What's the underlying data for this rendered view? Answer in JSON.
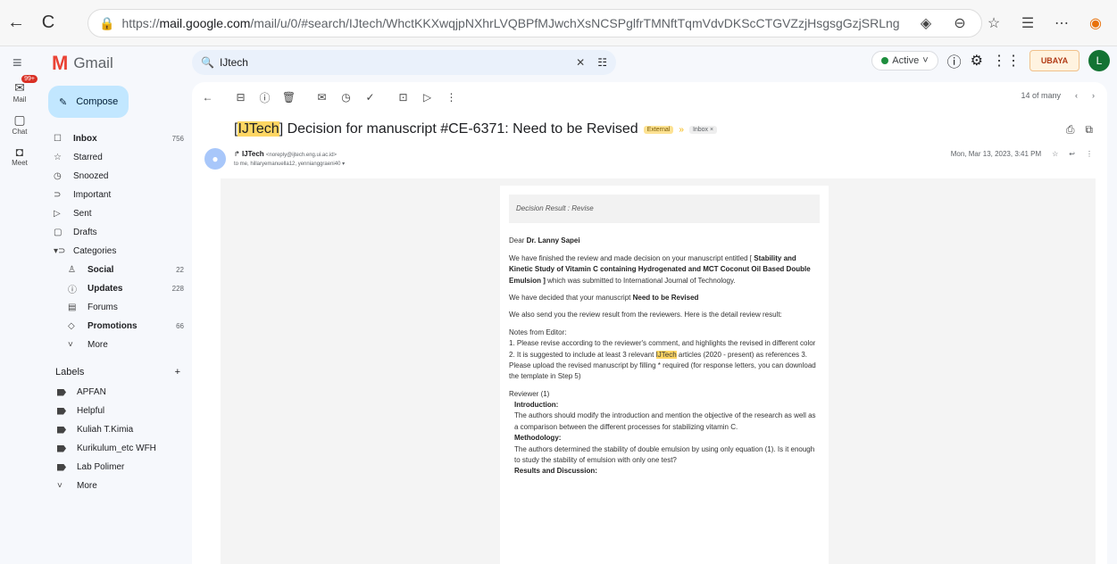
{
  "browser": {
    "back_icon": "←",
    "reload_icon": "C",
    "url_prefix": "https://",
    "url_host": "mail.google.com",
    "url_rest": "/mail/u/0/#search/IJtech/WhctKKXwqjpNXhrLVQBPfMJwchXsNCSPglfrTMNftTqmVdvDKScCTGVZzjHsgsgGzjSRLng"
  },
  "app": {
    "name": "Gmail"
  },
  "search": {
    "query": "IJtech"
  },
  "status": {
    "active_label": "Active"
  },
  "account": {
    "initial": "L",
    "org_badge": "UBAYA"
  },
  "rail": [
    {
      "label": "Mail",
      "badge": "99+"
    },
    {
      "label": "Chat"
    },
    {
      "label": "Meet"
    }
  ],
  "compose_label": "Compose",
  "folders": [
    {
      "label": "Inbox",
      "count": "756",
      "bold": true,
      "icon": "☐"
    },
    {
      "label": "Starred",
      "count": "",
      "icon": "☆"
    },
    {
      "label": "Snoozed",
      "count": "",
      "icon": "◷"
    },
    {
      "label": "Important",
      "count": "",
      "icon": "⊃"
    },
    {
      "label": "Sent",
      "count": "",
      "icon": "▷"
    },
    {
      "label": "Drafts",
      "count": "",
      "icon": "▢"
    },
    {
      "label": "Categories",
      "count": "",
      "icon": "▾⊃"
    }
  ],
  "categories": [
    {
      "label": "Social",
      "count": "22",
      "bold": true,
      "icon": "♙"
    },
    {
      "label": "Updates",
      "count": "228",
      "bold": true,
      "icon": "ⓘ"
    },
    {
      "label": "Forums",
      "count": "",
      "icon": "▤"
    },
    {
      "label": "Promotions",
      "count": "66",
      "bold": true,
      "icon": "◇"
    }
  ],
  "more_label": "More",
  "labels_title": "Labels",
  "labels": [
    "APFAN",
    "Helpful",
    "Kuliah T.Kimia",
    "Kurikulum_etc WFH",
    "Lab Polimer"
  ],
  "pager": {
    "text": "14 of many"
  },
  "email": {
    "subject_tag": "IJTech",
    "subject_rest": "Decision for manuscript #CE-6371: Need to be Revised",
    "external_chip": "External",
    "inbox_chip": "Inbox ×",
    "sender_name": "IJTech",
    "sender_email": "<noreply@ijtech.eng.ui.ac.id>",
    "recipients": "to me, hillaryemanuella12, yennianggraeni40",
    "date": "Mon, Mar 13, 2023, 3:41 PM",
    "body": {
      "decision": "Decision Result : Revise",
      "greeting_prefix": "Dear",
      "greeting_name": "Dr. Lanny Sapei",
      "p1_prefix": "We have finished the review and made decision on your manuscript entitled [",
      "p1_title": "Stability and Kinetic Study of Vitamin C containing Hydrogenated and MCT Coconut Oil Based Double Emulsion ]",
      "p1_suffix": "which was submitted to International Journal of Technology.",
      "p2_prefix": "We have decided that your manuscript",
      "p2_bold": "Need to be Revised",
      "p3": "We also send you the review result from the reviewers. Here is the detail review result:",
      "notes_title": "Notes from Editor:",
      "notes_a": "1. Please revise according to the reviewer's comment, and highlights the revised in different color 2. It is suggested to include at least 3 relevant",
      "notes_hl": "IJTech",
      "notes_b": "articles (2020 - present) as references 3. Please upload the revised manuscript by filling * required (for response letters, you can download the template in Step 5)",
      "reviewer": "Reviewer (1)",
      "intro_head": "Introduction:",
      "intro_text": "The authors should modify the introduction and mention the objective of the research as well as a comparison between the different processes for stabilizing vitamin C.",
      "method_head": "Methodology:",
      "method_text": "The authors determined the stability of double emulsion by using only equation (1). Is it enough to study the stability of emulsion with only one test?",
      "results_head": "Results and Discussion:"
    }
  }
}
